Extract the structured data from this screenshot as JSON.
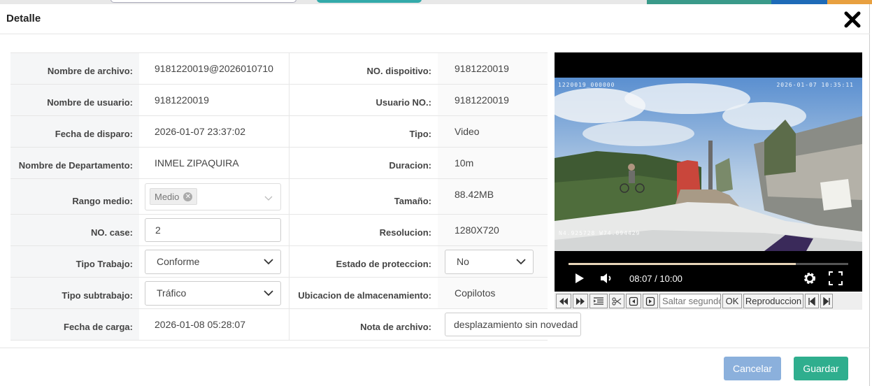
{
  "dialog": {
    "title": "Detalle"
  },
  "fields": {
    "nombre_archivo": {
      "label": "Nombre de archivo:",
      "value": "9181220019@2026010710"
    },
    "no_dispositivo": {
      "label": "NO. dispoitivo:",
      "value": "9181220019"
    },
    "nombre_usuario": {
      "label": "Nombre de usuario:",
      "value": "9181220019"
    },
    "usuario_no": {
      "label": "Usuario NO.:",
      "value": "9181220019"
    },
    "fecha_disparo": {
      "label": "Fecha de disparo:",
      "value": "2026-01-07 23:37:02"
    },
    "tipo": {
      "label": "Tipo:",
      "value": "Video"
    },
    "departamento": {
      "label": "Nombre de Departamento:",
      "value": "INMEL ZIPAQUIRA"
    },
    "duracion": {
      "label": "Duracion:",
      "value": "10m"
    },
    "rango_medio": {
      "label": "Rango medio:",
      "tag": "Medio"
    },
    "tamano": {
      "label": "Tamaño:",
      "value": "88.42MB"
    },
    "no_case": {
      "label": "NO. case:",
      "value": "2"
    },
    "resolucion": {
      "label": "Resolucion:",
      "value": "1280X720"
    },
    "tipo_trabajo": {
      "label": "Tipo Trabajo:",
      "value": "Conforme"
    },
    "estado_proteccion": {
      "label": "Estado de proteccion:",
      "value": "No"
    },
    "tipo_subtrabajo": {
      "label": "Tipo subtrabajo:",
      "value": "Tráfico"
    },
    "ubicacion": {
      "label": "Ubicacion de almacenamiento:",
      "value": "Copilotos"
    },
    "fecha_carga": {
      "label": "Fecha de carga:",
      "value": "2026-01-08 05:28:07"
    },
    "nota": {
      "label": "Nota de archivo:",
      "value": "desplazamiento sin novedad - vc"
    }
  },
  "video": {
    "osd_top_left": "1220019_000000",
    "osd_top_right": "2026-01-07 10:35:11",
    "osd_bottom_left": "N4.925728  W74.094429",
    "time": "08:07 / 10:00",
    "progress": 0.812
  },
  "toolbar": {
    "seek_placeholder": "Saltar segundos",
    "ok_label": "OK",
    "play_label": "Reproduccion"
  },
  "footer": {
    "cancel_label": "Cancelar",
    "save_label": "Guardar"
  }
}
